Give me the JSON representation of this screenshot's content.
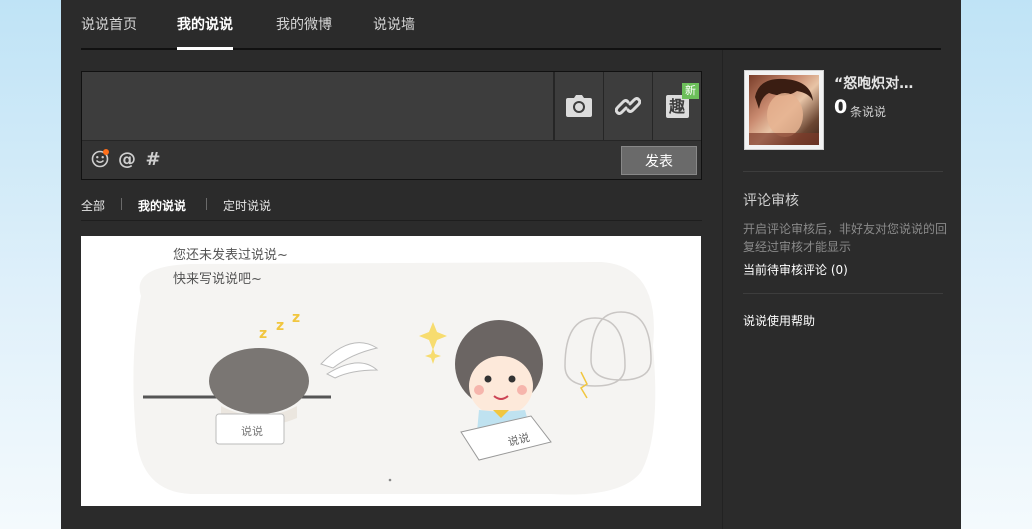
{
  "nav": {
    "tabs": [
      {
        "label": "说说首页"
      },
      {
        "label": "我的说说"
      },
      {
        "label": "我的微博"
      },
      {
        "label": "说说墙"
      }
    ],
    "active": "我的说说"
  },
  "composer": {
    "tools": [
      "camera-icon",
      "link-icon",
      "fun-icon"
    ],
    "fun_label": "趣",
    "new_badge": "新",
    "mini_tools": [
      "smiley-icon",
      "at-icon",
      "hashtag-icon"
    ],
    "at_symbol": "@",
    "hash_symbol": "#",
    "publish_label": "发表"
  },
  "filters": {
    "items": [
      {
        "label": "全部"
      },
      {
        "label": "我的说说"
      },
      {
        "label": "定时说说"
      }
    ],
    "active": "我的说说"
  },
  "empty_state": {
    "line1": "您还未发表过说说~",
    "line2": "快来写说说吧~",
    "paper1": "说说",
    "paper2": "说说"
  },
  "profile": {
    "name": "“怒咆炽对…",
    "count": "0",
    "count_label": "条说说"
  },
  "review": {
    "title": "评论审核",
    "desc": "开启评论审核后，非好友对您说说的回复经过审核才能显示",
    "pending": "当前待审核评论 (0)"
  },
  "help_link": "说说使用帮助",
  "colors": {
    "panel_bg": "#2b2b2b",
    "page_bg_top": "#bfe3f6",
    "badge_new": "#6cbf5a",
    "notify_dot": "#ff6f1a"
  }
}
